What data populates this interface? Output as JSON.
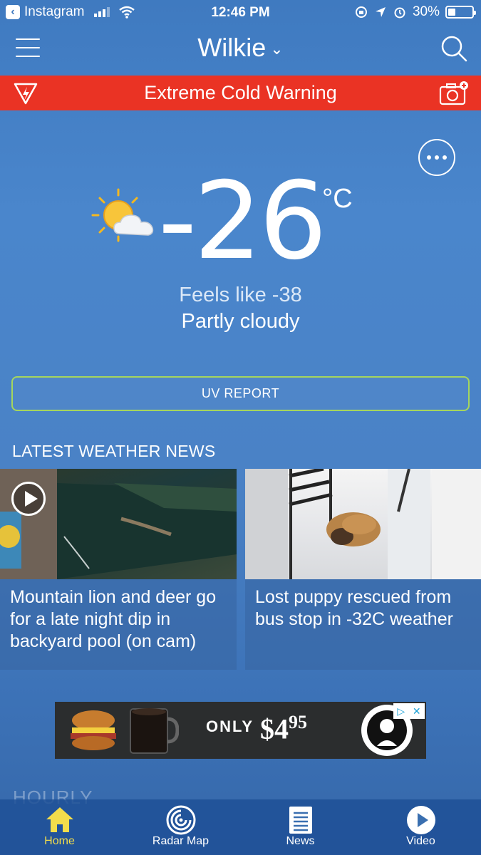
{
  "status_bar": {
    "back_app": "Instagram",
    "time": "12:46 PM",
    "battery": "30%"
  },
  "header": {
    "location": "Wilkie"
  },
  "alert": {
    "text": "Extreme Cold Warning",
    "color": "#ea3324"
  },
  "current": {
    "temperature": "-26",
    "unit": "°C",
    "feels_like": "Feels like -38",
    "condition": "Partly cloudy",
    "icon": "partly-cloudy-icon"
  },
  "uv_button": {
    "label": "UV REPORT",
    "border_color": "#a5d65e"
  },
  "news": {
    "heading": "LATEST WEATHER NEWS",
    "items": [
      {
        "title": "Mountain lion and deer go for a late night dip in backyard pool (on cam)",
        "has_video": true
      },
      {
        "title": "Lost puppy rescued from bus stop in -32C weather",
        "has_video": false
      }
    ]
  },
  "ad": {
    "text": "ONLY",
    "price": "$4",
    "cents": "95"
  },
  "hourly": {
    "label": "HOURLY"
  },
  "tabs": [
    {
      "label": "Home",
      "icon": "home-icon",
      "active": true
    },
    {
      "label": "Radar Map",
      "icon": "radar-icon",
      "active": false
    },
    {
      "label": "News",
      "icon": "news-icon",
      "active": false
    },
    {
      "label": "Video",
      "icon": "play-icon",
      "active": false
    }
  ],
  "colors": {
    "active_tab": "#f3dd4b",
    "background": "#4a86cc"
  }
}
